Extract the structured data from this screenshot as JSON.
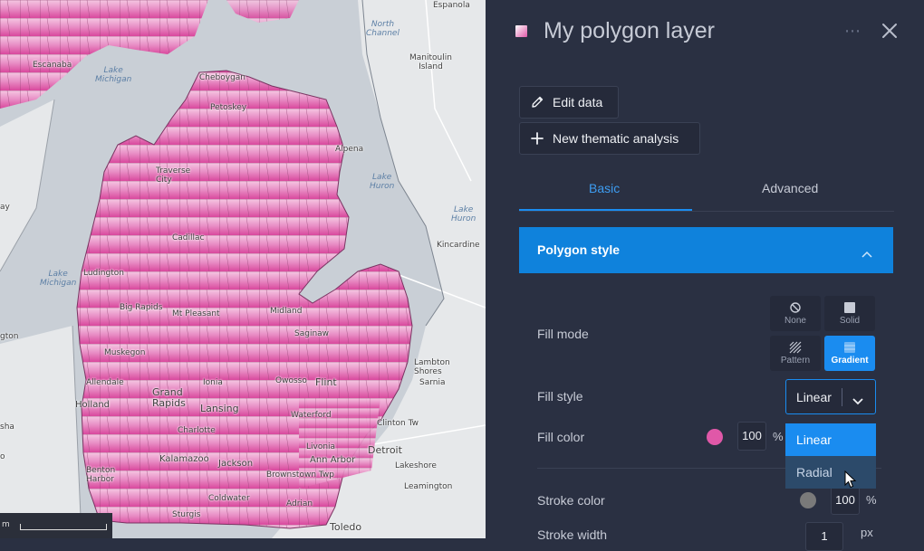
{
  "map": {
    "labels": {
      "espanola": "Espanola",
      "north_channel": "North\nChannel",
      "manitoulin": "Manitoulin\nIsland",
      "escanaba": "Escanaba",
      "lake_michigan_1": "Lake\nMichigan",
      "cheboygan": "Cheboygan",
      "petoskey": "Petoskey",
      "alpena": "Alpena",
      "traverse_city": "Traverse\nCity",
      "lake_huron_1": "Lake\nHuron",
      "lake_huron_2": "Lake\nHuron",
      "bay": "ay",
      "cadillac": "Cadillac",
      "kincardine": "Kincardine",
      "lake_michigan_2": "Lake\nMichigan",
      "ludington": "Ludington",
      "big_rapids": "Big Rapids",
      "mt_pleasant": "Mt Pleasant",
      "midland": "Midland",
      "saginaw": "Saginaw",
      "gton": "gton",
      "muskegon": "Muskegon",
      "lambton_shores": "Lambton\nShores",
      "sarnia": "Sarnia",
      "allendale": "Allendale",
      "grand_rapids": "Grand\nRapids",
      "ionia": "Ionia",
      "owosso": "Owosso",
      "flint": "Flint",
      "holland": "Holland",
      "lansing": "Lansing",
      "waterford": "Waterford",
      "clinton_twp": "Clinton Tw",
      "sha": "sha",
      "charlotte": "Charlotte",
      "livonia": "Livonia",
      "detroit": "Detroit",
      "kalamazoo": "Kalamazoo",
      "jackson": "Jackson",
      "ann_arbor": "Ann Arbor",
      "lakeshore": "Lakeshore",
      "benton_harbor": "Benton\nHarbor",
      "brownstown": "Brownstown Twp",
      "leamington": "Leamington",
      "coldwater": "Coldwater",
      "adrian": "Adrian",
      "sturgis": "Sturgis",
      "toledo": "Toledo",
      "o": "o"
    },
    "scale_label": "m"
  },
  "panel": {
    "layer_title": "My polygon layer",
    "more_icon": "⋯",
    "edit_data_label": "Edit data",
    "new_thematic_label": "New thematic analysis",
    "tabs": {
      "basic": "Basic",
      "advanced": "Advanced"
    },
    "section_title": "Polygon style",
    "fill_mode": {
      "label": "Fill mode",
      "options": {
        "none": "None",
        "solid": "Solid",
        "pattern": "Pattern",
        "gradient": "Gradient"
      },
      "selected": "Gradient"
    },
    "fill_style": {
      "label": "Fill style",
      "value": "Linear",
      "options": [
        "Linear",
        "Radial"
      ]
    },
    "fill_color": {
      "label": "Fill color",
      "color": "#e058a8",
      "opacity": "100",
      "unit": "%"
    },
    "stroke_color": {
      "label": "Stroke color",
      "color": "#7a7a7a",
      "opacity": "100",
      "unit": "%"
    },
    "stroke_width": {
      "label": "Stroke width",
      "value": "1",
      "unit": "px"
    }
  },
  "colors": {
    "accent": "#1a8cf0",
    "panel_bg": "#2a3042",
    "polygon_fill": "#e058a8",
    "water": "#c9cfd6",
    "land": "#e6e8ea"
  }
}
